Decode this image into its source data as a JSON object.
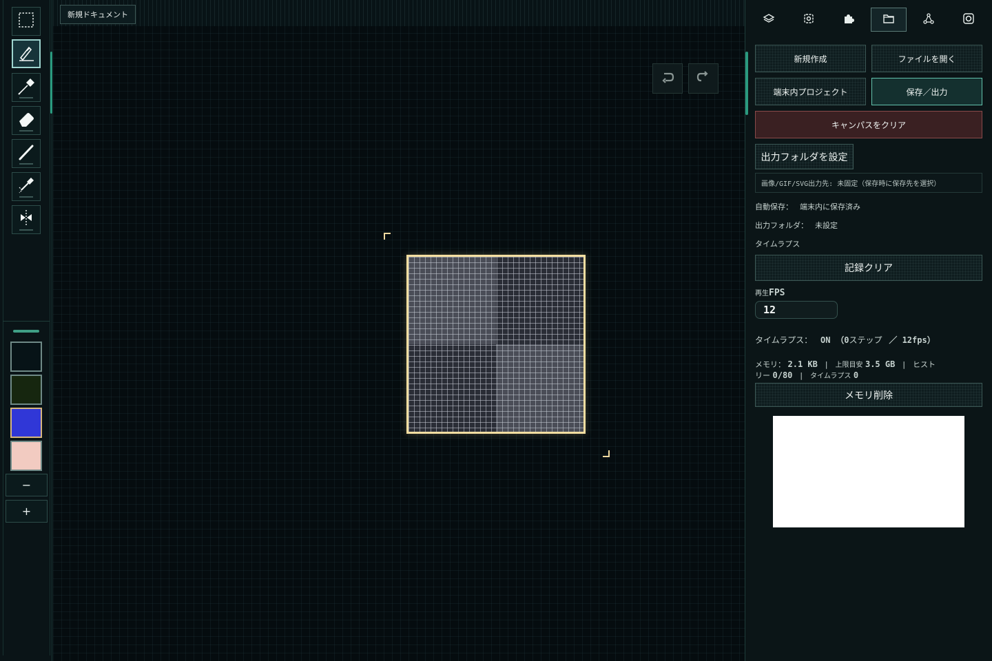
{
  "document": {
    "tab_label": "新規ドキュメント"
  },
  "toolbar": {
    "tools": [
      {
        "name": "select",
        "icon": "marquee-select-icon",
        "active": false
      },
      {
        "name": "pen",
        "icon": "pen-icon",
        "active": true
      },
      {
        "name": "eyedropper",
        "icon": "eyedropper-icon",
        "active": false
      },
      {
        "name": "eraser",
        "icon": "eraser-icon",
        "active": false
      },
      {
        "name": "line",
        "icon": "line-icon",
        "active": false
      },
      {
        "name": "fill",
        "icon": "bucket-fill-icon",
        "active": false
      },
      {
        "name": "mirror",
        "icon": "mirror-icon",
        "active": false
      }
    ],
    "swatches": [
      {
        "color": "#071317",
        "selected": false
      },
      {
        "color": "#16260f",
        "selected": false
      },
      {
        "color": "#3037d7",
        "selected": true
      },
      {
        "color": "#f2cbc1",
        "selected": false
      }
    ],
    "minus_label": "−",
    "plus_label": "+"
  },
  "canvas": {
    "colors": {
      "frame": "#f3dea1",
      "checker_dark": "#2a2d36",
      "checker_light": "#4a4d57"
    }
  },
  "panel": {
    "tabs": [
      {
        "icon": "layers-icon",
        "active": false
      },
      {
        "icon": "settings-icon",
        "active": false
      },
      {
        "icon": "puzzle-icon",
        "active": false
      },
      {
        "icon": "folder-icon",
        "active": true
      },
      {
        "icon": "nodes-icon",
        "active": false
      },
      {
        "icon": "record-icon",
        "active": false
      }
    ],
    "buttons": {
      "new": "新規作成",
      "open": "ファイルを開く",
      "local_projects": "端末内プロジェクト",
      "save_export": "保存／出力",
      "clear_canvas": "キャンパスをクリア",
      "set_output_folder": "出力フォルダを設定",
      "clear_record": "記録クリア",
      "delete_memory": "メモリ削除"
    },
    "output_path_text": "画像/GIF/SVG出力先: 未固定（保存時に保存先を選択）",
    "autosave": {
      "label": "自動保存：",
      "value": "端末内に保存済み"
    },
    "output_folder": {
      "label": "出力フォルダ：",
      "value": "未設定"
    },
    "timelapse_heading": "タイムラプス",
    "fps": {
      "label_prefix": "再生",
      "label_suffix": "FPS",
      "value": "12"
    },
    "timelapse_status": {
      "label": "タイムラプス：",
      "state": "ON",
      "open": "（0",
      "steps_label": "ステップ",
      "rate": "／ 12fps）"
    },
    "memory": {
      "label": "メモリ：",
      "value": "2.1 KB",
      "sep": "|",
      "limit_label": "上限目安",
      "limit_value": "3.5 GB",
      "history_label_a": "ヒスト",
      "history_label_b": "リー",
      "history_value": "0/80",
      "timelapse_label": "タイムラプス",
      "timelapse_value": "0"
    },
    "colors": {
      "accent": "#64c4ae",
      "danger_bg": "#3a2022",
      "danger_border": "#8a4a4a"
    }
  }
}
